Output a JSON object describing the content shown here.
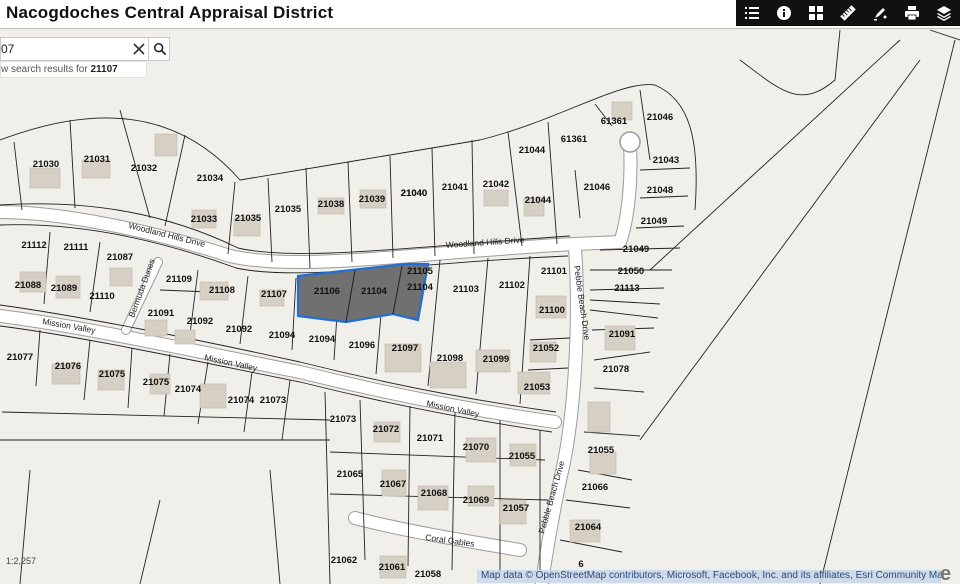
{
  "app": {
    "title": "Nacogdoches Central Appraisal District"
  },
  "toolbar": {
    "buttons": [
      {
        "name": "legend-list-icon"
      },
      {
        "name": "info-icon"
      },
      {
        "name": "grid-basemap-icon"
      },
      {
        "name": "measure-ruler-icon"
      },
      {
        "name": "draw-tool-icon"
      },
      {
        "name": "print-icon"
      },
      {
        "name": "layers-icon"
      }
    ]
  },
  "search": {
    "value": "07",
    "suggestion_prefix": "w search results for ",
    "suggestion_term": "21107"
  },
  "map": {
    "scale": "1:2,257",
    "attribution": "Map data © OpenStreetMap contributors, Microsoft, Facebook, Inc. and its affiliates, Esri Community Maps...",
    "colors": {
      "background": "#f1efe9",
      "road": "#ffffff",
      "parcel_line": "#222222",
      "building": "#d6cfc4",
      "selected_fill": "#707070",
      "selected_outline": "#1f6fd6"
    },
    "streets": [
      "Woodland Hills Drive",
      "Woodland Hills Drive",
      "Bermuda Dunes",
      "Mission Valley",
      "Mission Valley",
      "Mission Valley",
      "Pebble Beach Drive",
      "Pebble Beach Drive",
      "Coral Gables"
    ],
    "parcels": [
      "21030",
      "21031",
      "21032",
      "21034",
      "21033",
      "21035",
      "21035",
      "21038",
      "21039",
      "21040",
      "21040",
      "21041",
      "21042",
      "21044",
      "21044",
      "61361",
      "61361",
      "21046",
      "21043",
      "21046",
      "21048",
      "21049",
      "21049",
      "21050",
      "21113",
      "21112",
      "21111",
      "21087",
      "21088",
      "21089",
      "21110",
      "21109",
      "21108",
      "21107",
      "21106",
      "21104",
      "21105",
      "21104",
      "21103",
      "21102",
      "21101",
      "21100",
      "21052",
      "21091",
      "21091",
      "21092",
      "21092",
      "21094",
      "21094",
      "21096",
      "21097",
      "21098",
      "21099",
      "21053",
      "21078",
      "21077",
      "21076",
      "21075",
      "21075",
      "21074",
      "21074",
      "21073",
      "21073",
      "21072",
      "21071",
      "21070",
      "21055",
      "21055",
      "21066",
      "21065",
      "21067",
      "21068",
      "21069",
      "21057",
      "21064",
      "21062",
      "21061",
      "21058",
      "6"
    ]
  }
}
